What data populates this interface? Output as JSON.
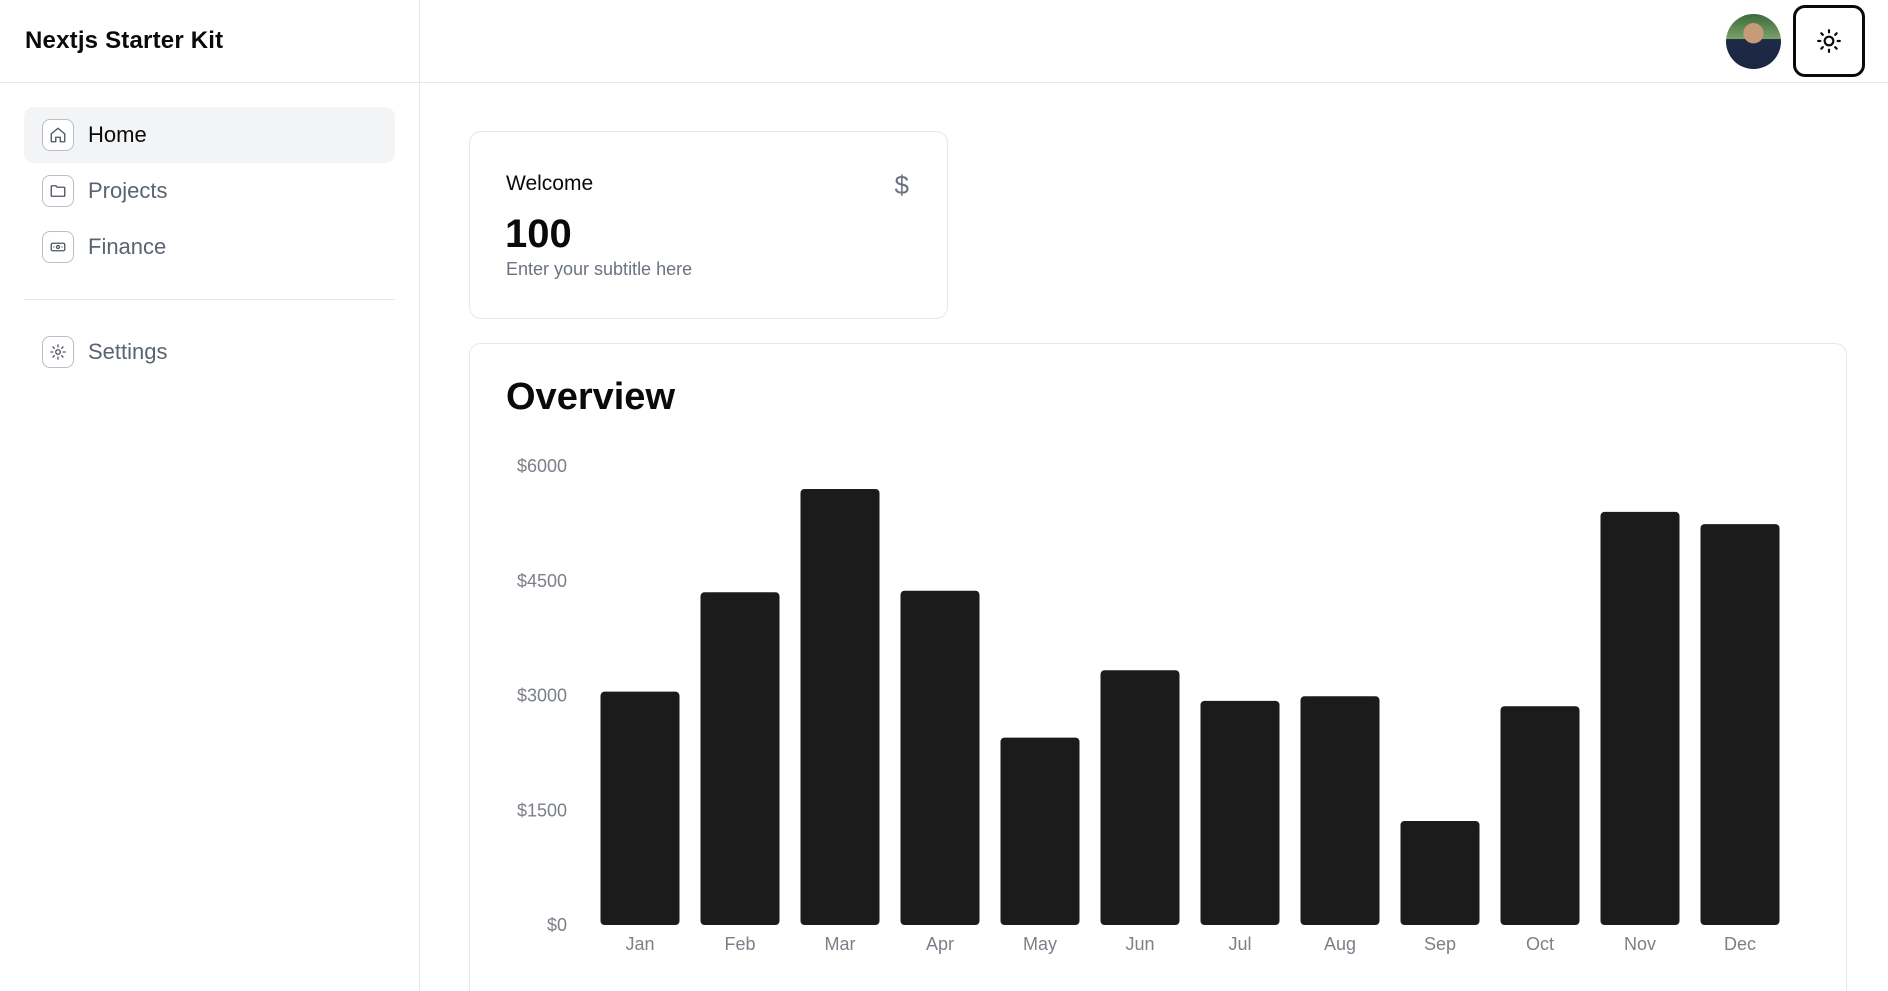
{
  "app": {
    "brand": "Nextjs Starter Kit"
  },
  "sidebar": {
    "items": [
      {
        "label": "Home",
        "icon": "home-icon",
        "active": true
      },
      {
        "label": "Projects",
        "icon": "folder-icon",
        "active": false
      },
      {
        "label": "Finance",
        "icon": "banknote-icon",
        "active": false
      }
    ],
    "settings": {
      "label": "Settings",
      "icon": "gear-icon"
    }
  },
  "header": {
    "avatar": "user-avatar",
    "theme_toggle_icon": "sun-icon"
  },
  "welcome_card": {
    "title": "Welcome",
    "icon": "dollar-icon",
    "icon_glyph": "$",
    "value": "100",
    "subtitle": "Enter your subtitle here"
  },
  "overview": {
    "title": "Overview"
  },
  "chart_data": {
    "type": "bar",
    "title": "Overview",
    "categories": [
      "Jan",
      "Feb",
      "Mar",
      "Apr",
      "May",
      "Jun",
      "Jul",
      "Aug",
      "Sep",
      "Oct",
      "Nov",
      "Dec"
    ],
    "values": [
      3050,
      4350,
      5700,
      4370,
      2450,
      3330,
      2930,
      2990,
      1360,
      2860,
      5400,
      5240
    ],
    "yticks": [
      "$6000",
      "$4500",
      "$3000",
      "$1500",
      "$0"
    ],
    "ylim": [
      0,
      6000
    ],
    "bar_color": "#1b1b1c",
    "xlabel": "",
    "ylabel": "",
    "grid": false
  }
}
